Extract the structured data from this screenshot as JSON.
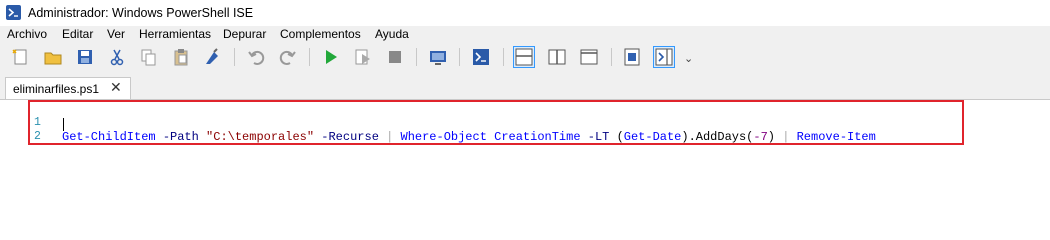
{
  "window": {
    "title": "Administrador: Windows PowerShell ISE",
    "icon": "powershell-icon"
  },
  "menu": [
    "Archivo",
    "Editar",
    "Ver",
    "Herramientas",
    "Depurar",
    "Complementos",
    "Ayuda"
  ],
  "toolbar": {
    "buttons": [
      "new-icon",
      "open-icon",
      "save-icon",
      "cut-icon",
      "copy-icon",
      "paste-icon",
      "clear-console-icon",
      "undo-icon",
      "redo-icon",
      "run-icon",
      "run-selection-icon",
      "stop-icon",
      "remote-powershell-icon",
      "powershell-console-icon",
      "script-pane-top-icon",
      "script-pane-right-icon",
      "script-pane-maximized-icon",
      "show-command-icon",
      "show-command-addon-icon"
    ],
    "overflow_glyph": "⌄"
  },
  "tabs": [
    {
      "label": "eliminarfiles.ps1",
      "close": "✕"
    }
  ],
  "editor": {
    "lines": [
      {
        "number": "1",
        "tokens": [
          {
            "text": "Get-ChildItem",
            "type": "cmd"
          },
          {
            "text": " ",
            "type": "txt"
          },
          {
            "text": "-Path",
            "type": "param"
          },
          {
            "text": " ",
            "type": "txt"
          },
          {
            "text": "\"C:\\temporales\"",
            "type": "str"
          },
          {
            "text": " ",
            "type": "txt"
          },
          {
            "text": "-Recurse",
            "type": "param"
          },
          {
            "text": " ",
            "type": "txt"
          },
          {
            "text": "|",
            "type": "op"
          },
          {
            "text": " ",
            "type": "txt"
          },
          {
            "text": "Where-Object",
            "type": "cmd"
          },
          {
            "text": " ",
            "type": "txt"
          },
          {
            "text": "CreationTime",
            "type": "cmd"
          },
          {
            "text": " ",
            "type": "txt"
          },
          {
            "text": "-LT",
            "type": "param"
          },
          {
            "text": " ",
            "type": "txt"
          },
          {
            "text": "(",
            "type": "txt"
          },
          {
            "text": "Get-Date",
            "type": "cmd"
          },
          {
            "text": ").AddDays(",
            "type": "txt"
          },
          {
            "text": "-7",
            "type": "num"
          },
          {
            "text": ")",
            "type": "txt"
          },
          {
            "text": " ",
            "type": "txt"
          },
          {
            "text": "|",
            "type": "op"
          },
          {
            "text": " ",
            "type": "txt"
          },
          {
            "text": "Remove-Item",
            "type": "cmd"
          }
        ]
      },
      {
        "number": "2",
        "tokens": []
      }
    ],
    "highlight_color": "#e0242c"
  }
}
